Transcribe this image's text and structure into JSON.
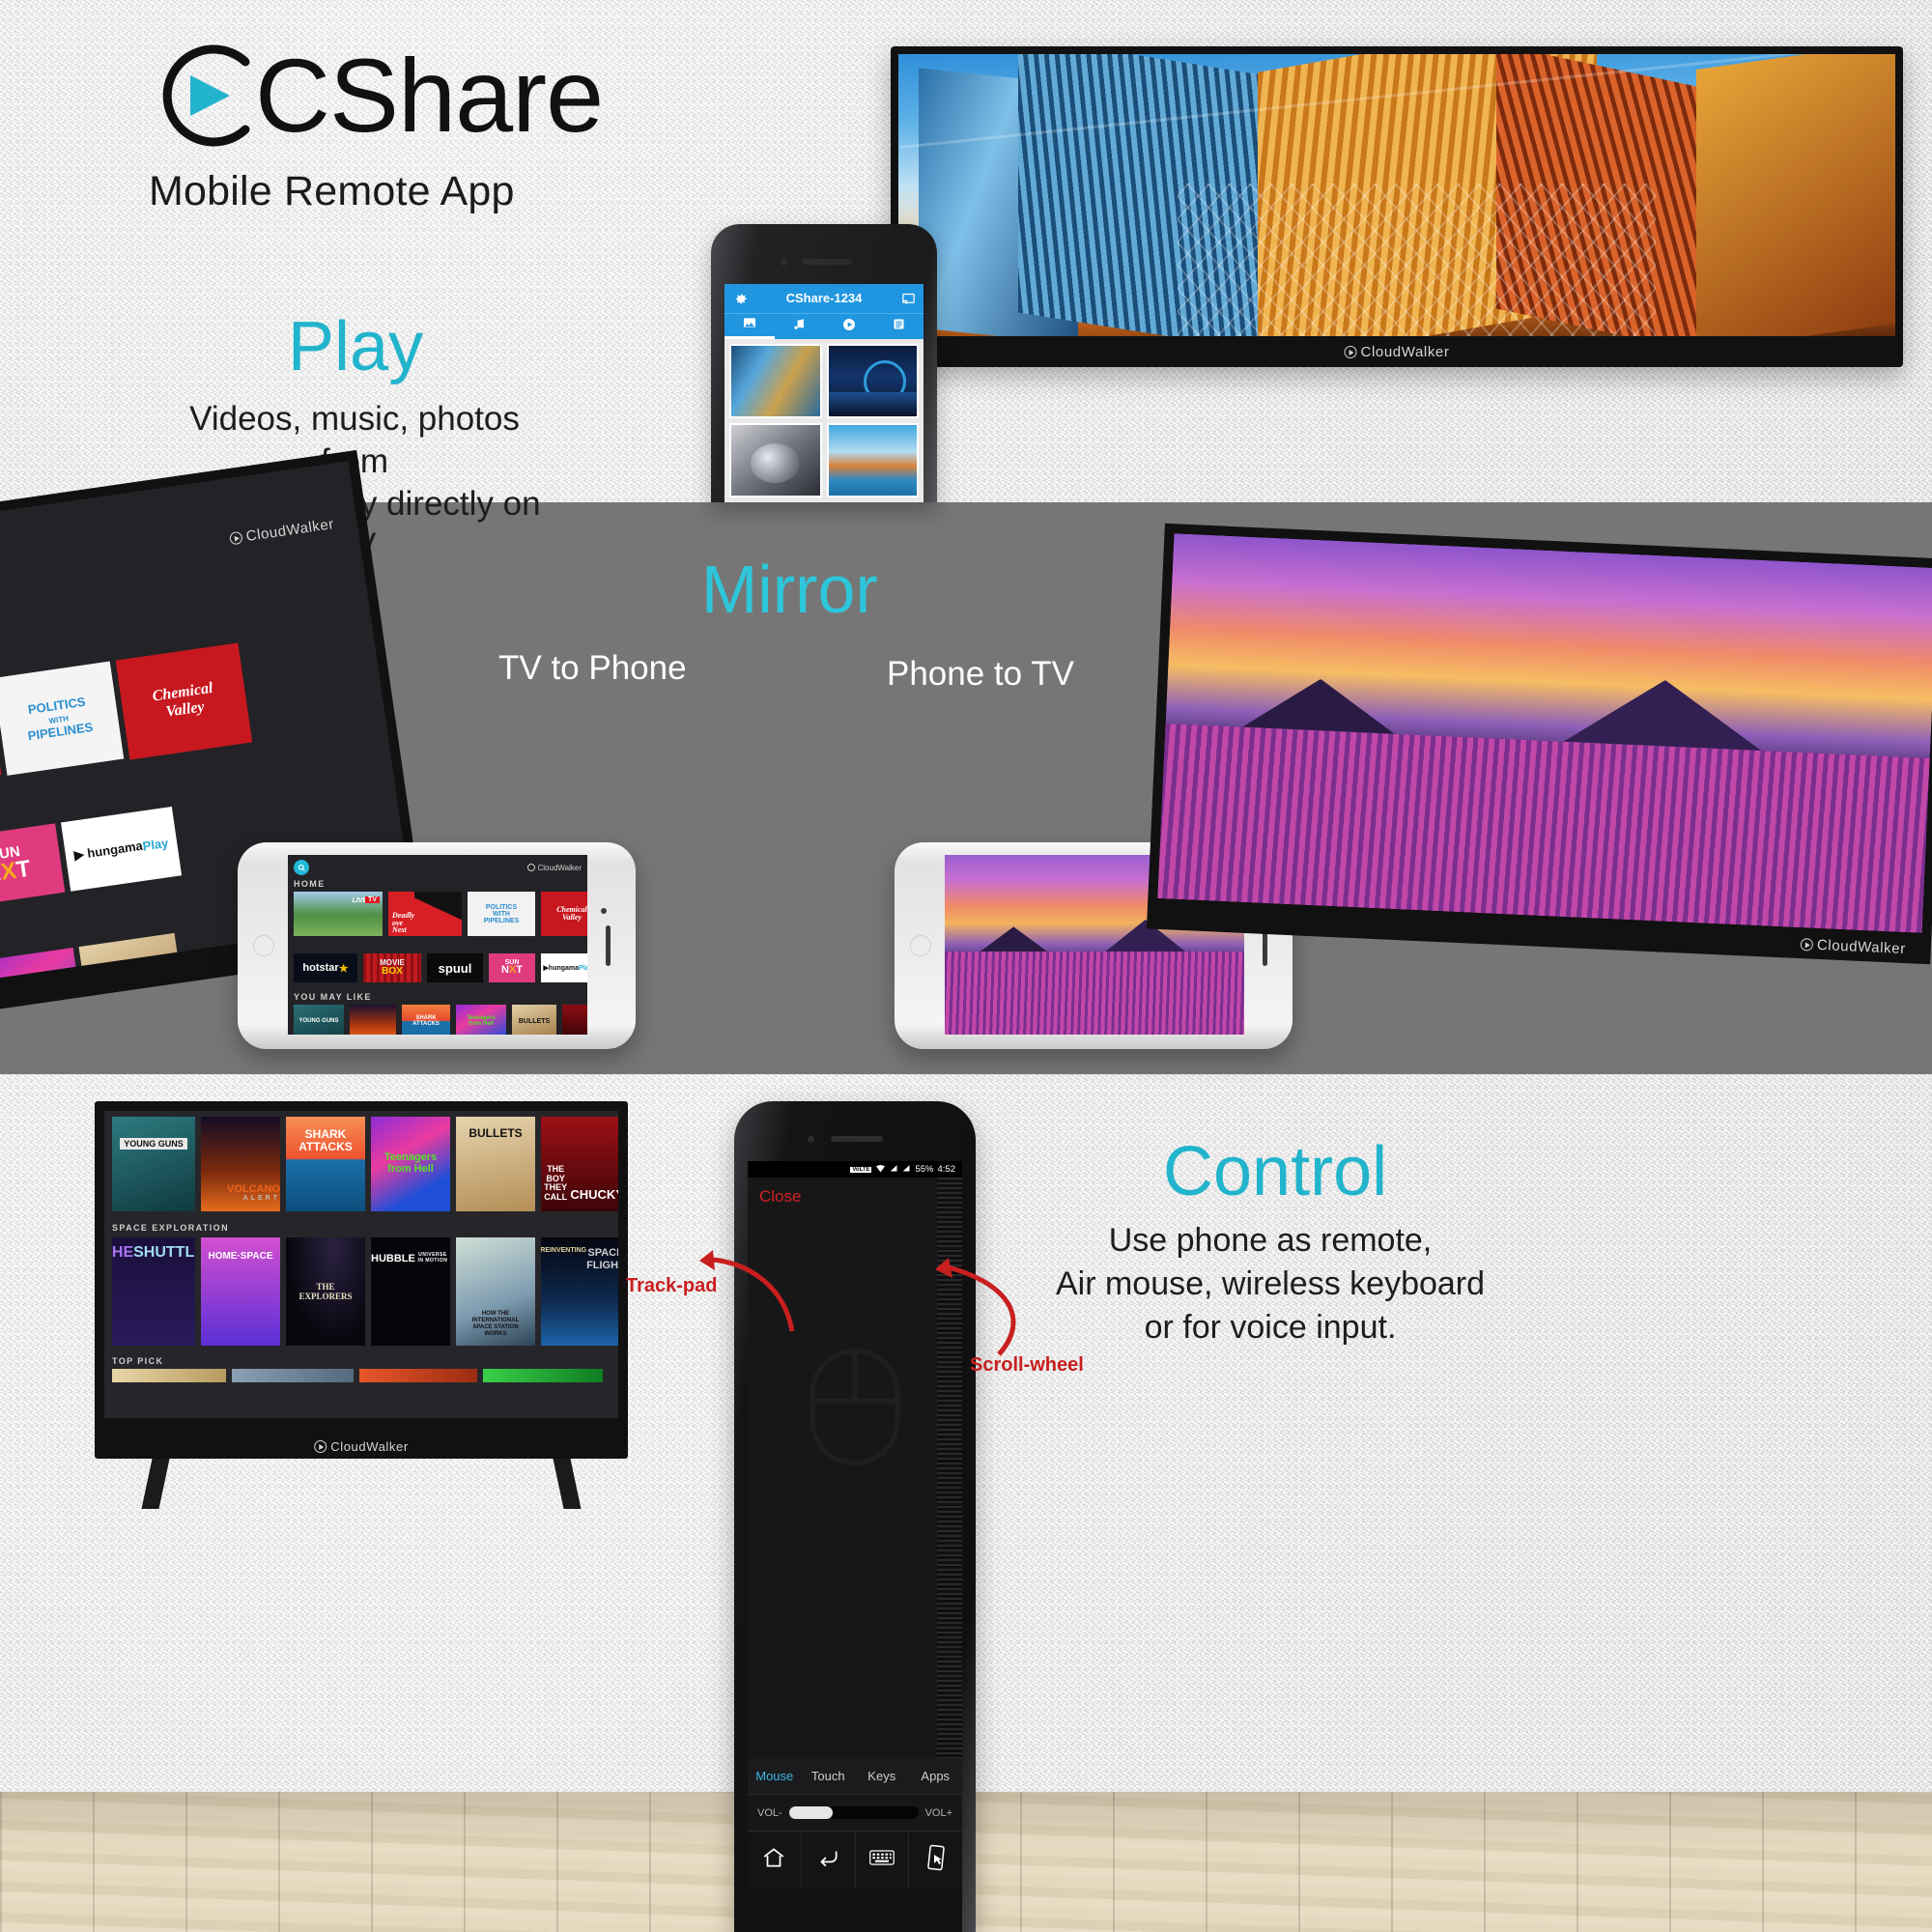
{
  "brand": {
    "logo_text": "CShare",
    "logo_icon": "play-circle-icon",
    "tagline": "Mobile Remote App",
    "accent_color": "#22b4cc",
    "tv_brand": "CloudWalker"
  },
  "sections": {
    "play": {
      "heading": "Play",
      "description": "Videos, music, photos from\nmobile gallery directly on TV"
    },
    "mirror": {
      "heading": "Mirror",
      "left_label": "TV to Phone",
      "right_label": "Phone to TV"
    },
    "control": {
      "heading": "Control",
      "description": "Use phone as remote,\nAir mouse, wireless keyboard\nor for voice input.",
      "callout_trackpad": "Track-pad",
      "callout_scrollwheel": "Scroll-wheel"
    }
  },
  "play_phone_app": {
    "settings_icon": "gear-icon",
    "title": "CShare-1234",
    "cast_icon": "cast-icon",
    "tabs": [
      {
        "label": "Photos",
        "icon": "image-icon",
        "active": true
      },
      {
        "label": "Music",
        "icon": "music-note-icon",
        "active": false
      },
      {
        "label": "Video",
        "icon": "play-circle-icon",
        "active": false
      },
      {
        "label": "Files",
        "icon": "list-icon",
        "active": false
      }
    ],
    "gallery": [
      {
        "name": "architecture-building"
      },
      {
        "name": "london-eye-night"
      },
      {
        "name": "astronaut-helmet"
      },
      {
        "name": "colorful-harbour-town"
      }
    ]
  },
  "control_phone_app": {
    "status_bar": {
      "network": "VoLTE",
      "wifi": "wifi-icon",
      "signal": "signal-icon",
      "battery": "55%",
      "time": "4:52"
    },
    "close_label": "Close",
    "trackpad_icon": "mouse-icon",
    "tabs": [
      {
        "label": "Mouse",
        "active": true
      },
      {
        "label": "Touch",
        "active": false
      },
      {
        "label": "Keys",
        "active": false
      },
      {
        "label": "Apps",
        "active": false
      }
    ],
    "volume": {
      "minus_label": "VOL-",
      "plus_label": "VOL+",
      "level_percent": 34
    },
    "nav_buttons": [
      {
        "name": "home-icon"
      },
      {
        "name": "back-icon"
      },
      {
        "name": "keyboard-icon"
      },
      {
        "name": "gesture-icon"
      }
    ]
  },
  "tv_home_ui": {
    "search_icon": "search-icon",
    "home_label": "HOME",
    "featured": [
      {
        "title": "LIVE TV",
        "kind": "cricket-live-tv"
      },
      {
        "title": "Deadly Love Nest",
        "kind": "red-black-poster"
      },
      {
        "title": "POLITICS WITH PIPELINES",
        "kind": "white-valve-poster"
      },
      {
        "title": "Chemical Valley",
        "kind": "red-script-poster"
      }
    ],
    "apps": [
      {
        "name": "hotstar"
      },
      {
        "name": "MOVIE BOX"
      },
      {
        "name": "spuul"
      },
      {
        "name": "SUN NXT"
      },
      {
        "name": "hungama Play"
      }
    ],
    "you_may_like_label": "YOU MAY LIKE",
    "you_may_like": [
      {
        "title": "YOUNG GUNS"
      },
      {
        "title": "VOLCANO ALERT"
      },
      {
        "title": "SHARK ATTACKS"
      },
      {
        "title": "Teenagers from Hell"
      },
      {
        "title": "BULLETS"
      },
      {
        "title": "THE BOY THEY CALL CHUCKY"
      }
    ],
    "space_section_label": "SPACE EXPLORATION",
    "space_items": [
      {
        "title": "THE SHUTTLE"
      },
      {
        "title": "HOME·SPACE"
      },
      {
        "title": "THE EXPLORERS"
      },
      {
        "title": "HUBBLE UNIVERSE IN MOTION"
      },
      {
        "title": "HOW THE INTERNATIONAL SPACE STATION WORKS"
      },
      {
        "title": "REINVENTING SPACE FLIGHT"
      }
    ],
    "top_pick_label": "TOP PICK"
  }
}
